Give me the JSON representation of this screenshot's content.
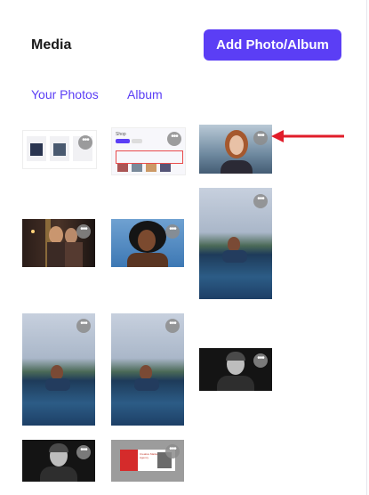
{
  "header": {
    "title": "Media",
    "add_button": "Add Photo/Album"
  },
  "tabs": [
    {
      "label": "Your Photos"
    },
    {
      "label": "Album"
    }
  ],
  "more_glyph": "•••",
  "colors": {
    "accent": "#5b3ef5",
    "arrow": "#e11d2a"
  },
  "thumbnails": [
    {
      "name": "screenshot-social-feed"
    },
    {
      "name": "screenshot-shop-page",
      "text": "Shop"
    },
    {
      "name": "woman-red-hair"
    },
    {
      "name": "two-women-candles"
    },
    {
      "name": "woman-afro-hair"
    },
    {
      "name": "man-in-sea-tall"
    },
    {
      "name": "man-in-sea-1"
    },
    {
      "name": "man-in-sea-2"
    },
    {
      "name": "man-bw-smiling"
    },
    {
      "name": "man-bw-smiling-2"
    },
    {
      "name": "creative-banner",
      "text": "Creative Marketing Agency"
    }
  ]
}
